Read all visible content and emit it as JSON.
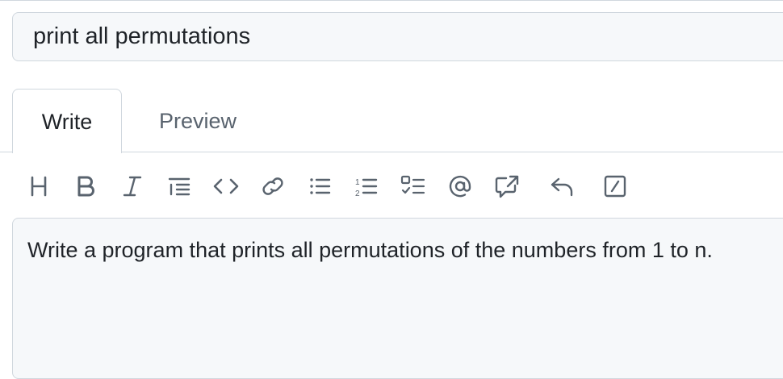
{
  "title": {
    "value": "print all permutations"
  },
  "tabs": [
    {
      "label": "Write"
    },
    {
      "label": "Preview"
    }
  ],
  "toolbar": {
    "icons": [
      "heading-icon",
      "bold-icon",
      "italic-icon",
      "quote-icon",
      "code-icon",
      "link-icon",
      "unordered-list-icon",
      "ordered-list-icon",
      "task-list-icon",
      "mention-icon",
      "cross-reference-icon",
      "reply-icon",
      "slash-command-icon"
    ]
  },
  "body": {
    "value": "Write a program that prints all permutations of the numbers from 1 to n."
  }
}
